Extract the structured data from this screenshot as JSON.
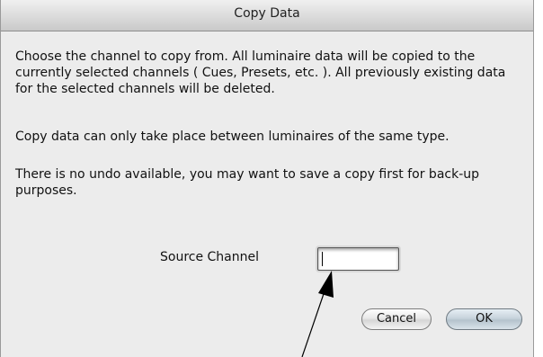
{
  "dialog": {
    "title": "Copy Data",
    "paragraphs": [
      "Choose the channel to copy from.  All luminaire data will be copied to the currently selected channels ( Cues, Presets, etc. ).  All previously existing data for the selected channels will be deleted.",
      "Copy data can only take place between luminaires of the same type.",
      "There is no undo available, you may want to save a copy first for back-up purposes."
    ],
    "source_label": "Source Channel",
    "source_value": "",
    "buttons": {
      "cancel": "Cancel",
      "ok": "OK"
    }
  },
  "annotation": {
    "pointer_icon": "arrow-icon"
  }
}
